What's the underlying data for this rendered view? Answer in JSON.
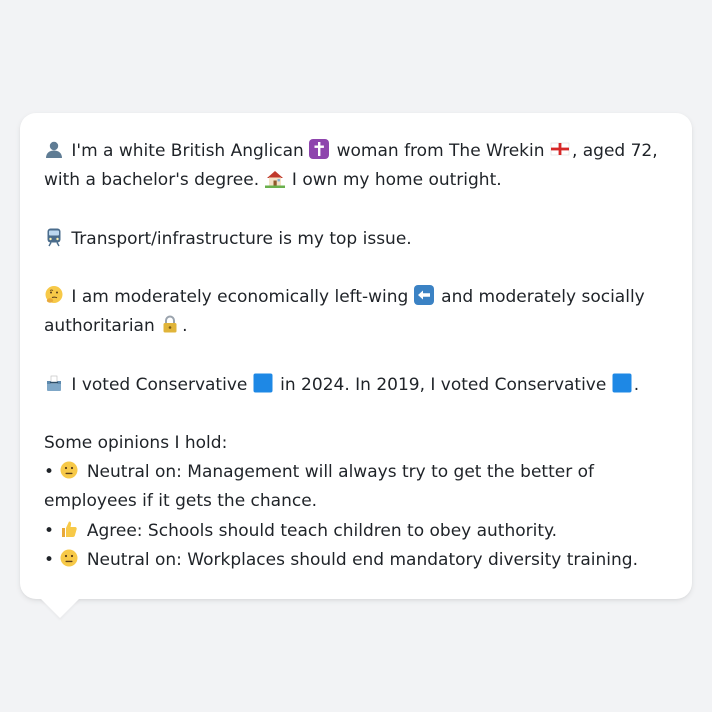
{
  "profile": {
    "p1": {
      "icon_person": "person-silhouette-icon",
      "text_a": "I'm a white British Anglican",
      "icon_religion": "latin-cross-icon",
      "text_b": "woman from The Wrekin",
      "icon_flag": "england-flag-icon",
      "text_c": ", aged 72, with a bachelor's degree.",
      "icon_home": "house-icon",
      "text_d": "I own my home outright."
    },
    "p2": {
      "icon": "train-icon",
      "text": "Transport/infrastructure is my top issue."
    },
    "p3": {
      "icon_thinking": "thinking-face-icon",
      "text_a": "I am moderately economically left-wing",
      "icon_left": "left-arrow-icon",
      "text_b": "and moderately socially authoritarian",
      "icon_lock": "lock-icon",
      "text_c": "."
    },
    "p4": {
      "icon_ballot": "ballot-box-icon",
      "text_a": "I voted Conservative",
      "icon_party1": "blue-square-icon",
      "text_b": "in 2024. In 2019, I voted Conservative",
      "icon_party2": "blue-square-icon",
      "text_c": "."
    },
    "opinions_heading": "Some opinions I hold:",
    "opinions": [
      {
        "bullet": "•",
        "icon": "neutral-face-icon",
        "text": "Neutral on: Management will always try to get the better of employees if it gets the chance."
      },
      {
        "bullet": "•",
        "icon": "thumbs-up-icon",
        "text": "Agree: Schools should teach children to obey authority."
      },
      {
        "bullet": "•",
        "icon": "neutral-face-icon",
        "text": "Neutral on: Workplaces should end mandatory diversity training."
      }
    ]
  },
  "colors": {
    "background": "#f2f3f5",
    "bubble": "#ffffff",
    "text": "#1f2328",
    "party_blue": "#1e88e5"
  }
}
